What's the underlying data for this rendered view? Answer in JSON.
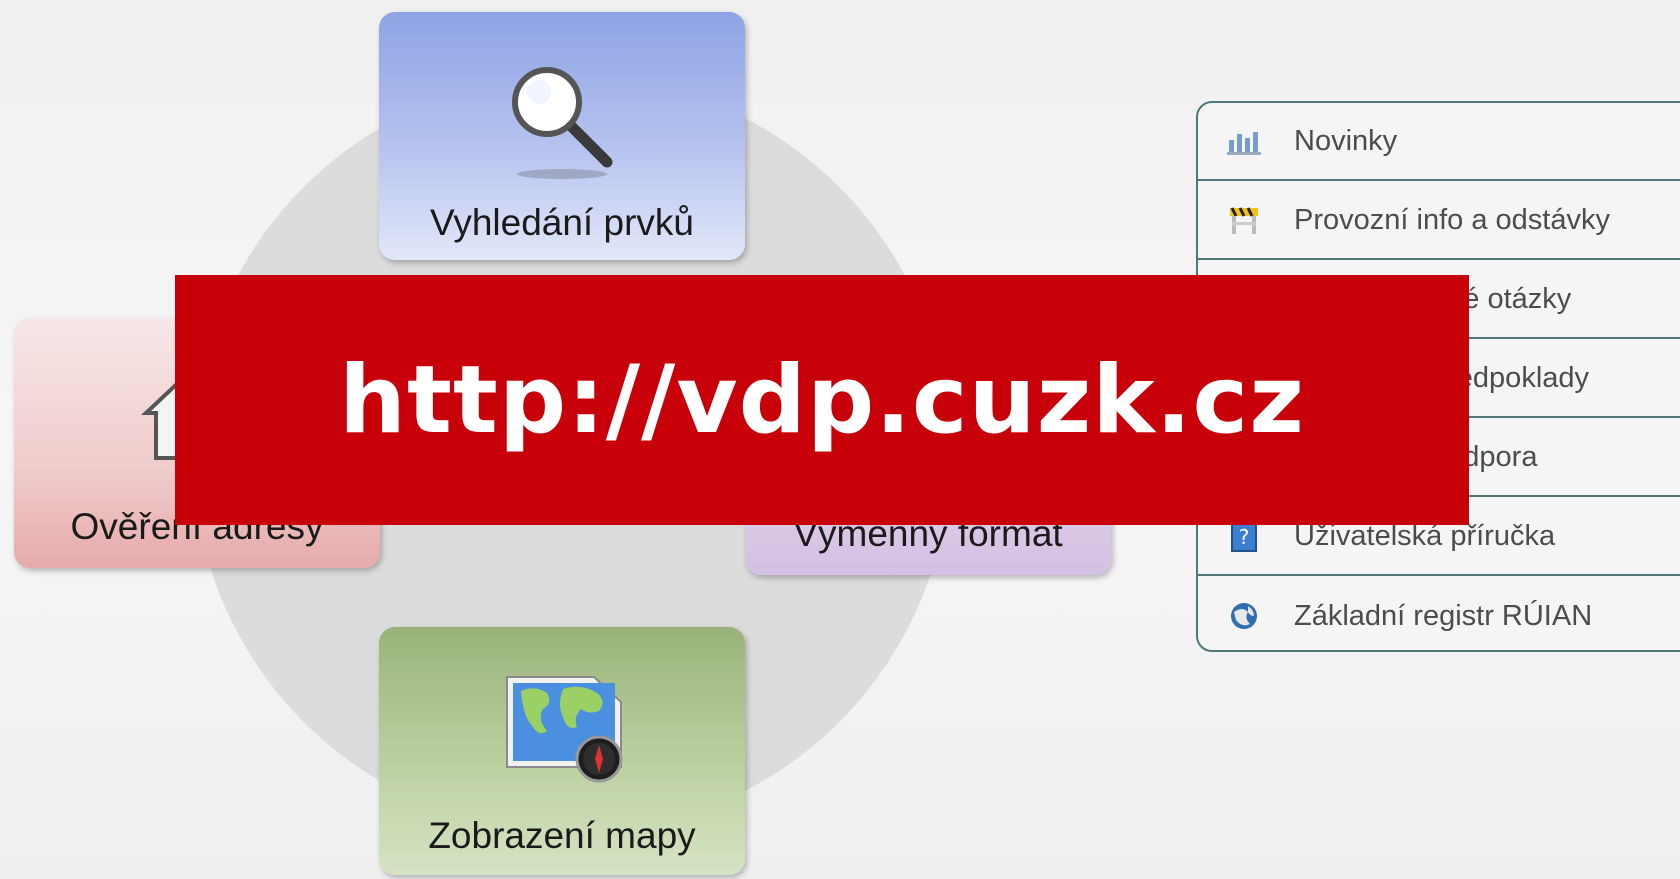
{
  "tiles": {
    "search": {
      "label": "Vyhledání prvků",
      "icon": "magnifier-icon"
    },
    "address": {
      "label": "Ověření adresy",
      "icon": "house-icon"
    },
    "exchange": {
      "label": "Výměnný formát",
      "icon": "exchange-format-icon"
    },
    "map": {
      "label": "Zobrazení mapy",
      "icon": "world-map-icon"
    }
  },
  "menu": {
    "items": [
      {
        "label": "Novinky",
        "icon": "news-icon"
      },
      {
        "label": "Provozní info a odstávky",
        "icon": "roadblock-icon"
      },
      {
        "label": "Často kladené otázky",
        "icon": "faq-icon"
      },
      {
        "label": "Technické předpoklady",
        "icon": "requirements-icon"
      },
      {
        "label": "Technická podpora",
        "icon": "support-icon"
      },
      {
        "label": "Uživatelská příručka",
        "icon": "help-book-icon"
      },
      {
        "label": "Základní registr RÚIAN",
        "icon": "globe-register-icon"
      }
    ]
  },
  "banner": {
    "text": "http://vdp.cuzk.cz"
  },
  "colors": {
    "banner": "#c8000a",
    "menu_border": "#4d7a78",
    "search_tile": "#8ea3e4",
    "address_tile": "#f0cccc",
    "exchange_tile": "#e0d0ea",
    "map_tile": "#9ab37a"
  }
}
